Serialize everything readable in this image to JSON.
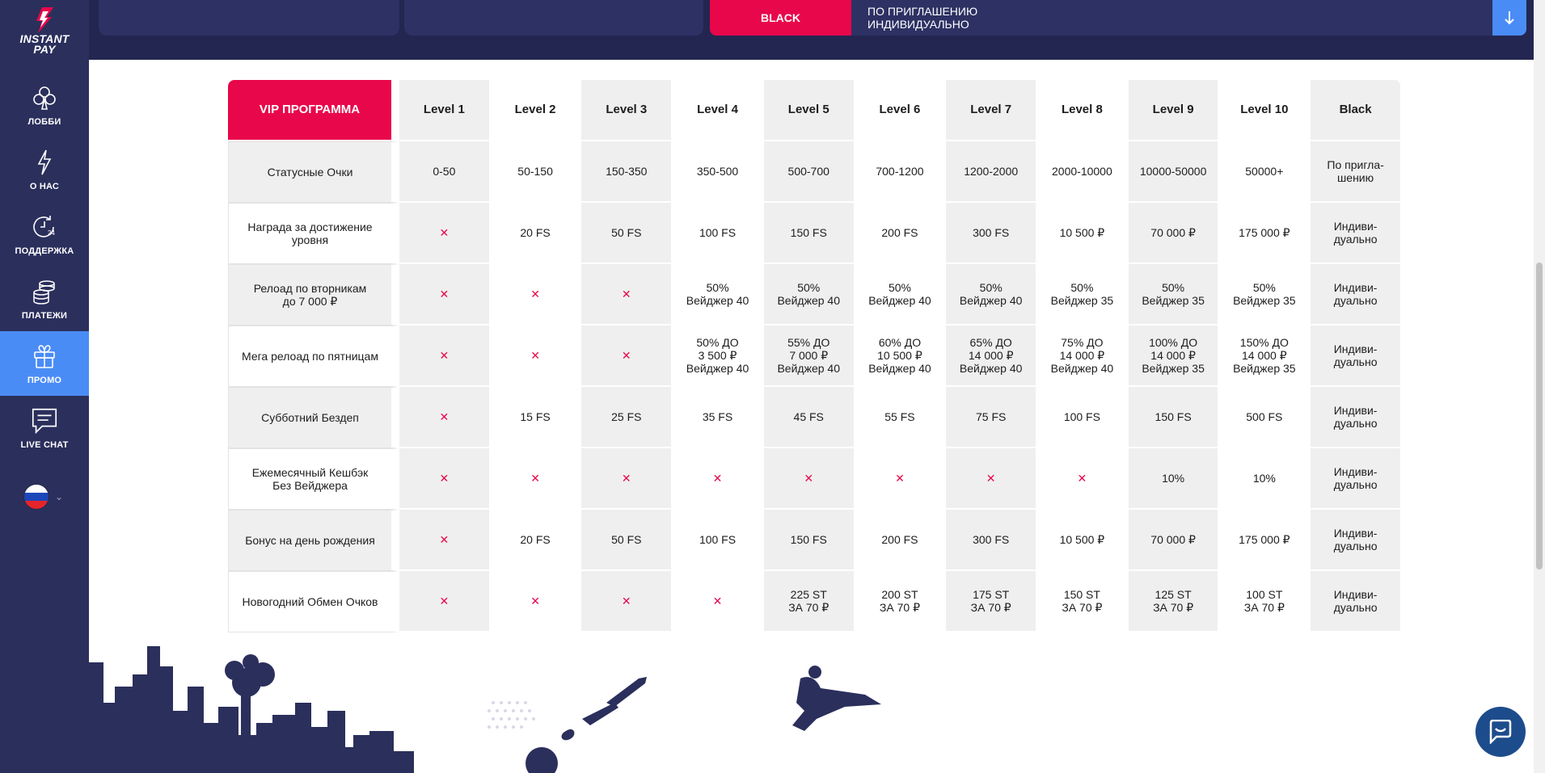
{
  "app": {
    "logo_line1": "INSTANT",
    "logo_line2": "PAY"
  },
  "sidebar": {
    "items": [
      {
        "label": "ЛОББИ",
        "icon": "club-icon"
      },
      {
        "label": "О НАС",
        "icon": "lightning-icon"
      },
      {
        "label": "ПОДДЕРЖКА",
        "icon": "clock-24-icon"
      },
      {
        "label": "ПЛАТЕЖИ",
        "icon": "coins-icon"
      },
      {
        "label": "ПРОМО",
        "icon": "gift-icon"
      },
      {
        "label": "LIVE CHAT",
        "icon": "chat-icon"
      }
    ],
    "active_index": 4,
    "language": "ru"
  },
  "top_banner": {
    "button": "BLACK",
    "text_line1": "ПО ПРИГЛАШЕНИЮ",
    "text_line2": "ИНДИВИДУАЛЬНО"
  },
  "table": {
    "corner": "VIP ПРОГРАММА",
    "columns": [
      "Level 1",
      "Level 2",
      "Level 3",
      "Level 4",
      "Level 5",
      "Level 6",
      "Level 7",
      "Level 8",
      "Level 9",
      "Level 10",
      "Black"
    ],
    "rows": [
      {
        "label": "Статусные Очки",
        "cells": [
          "0-50",
          "50-150",
          "150-350",
          "350-500",
          "500-700",
          "700-1200",
          "1200-2000",
          "2000-10000",
          "10000-50000",
          "50000+",
          "По пригла-\nшению"
        ]
      },
      {
        "label": "Награда за достижение\nуровня",
        "cells": [
          "✕",
          "20 FS",
          "50 FS",
          "100 FS",
          "150 FS",
          "200 FS",
          "300 FS",
          "10 500 ₽",
          "70 000 ₽",
          "175 000 ₽",
          "Индиви-\nдуально"
        ]
      },
      {
        "label": "Релоад по вторникам\nдо 7 000 ₽",
        "cells": [
          "✕",
          "✕",
          "✕",
          "50%\nВейджер 40",
          "50%\nВейджер 40",
          "50%\nВейджер 40",
          "50%\nВейджер 40",
          "50%\nВейджер 35",
          "50%\nВейджер 35",
          "50%\nВейджер 35",
          "Индиви-\nдуально"
        ]
      },
      {
        "label": "Мега релоад по пятницам",
        "cells": [
          "✕",
          "✕",
          "✕",
          "50% ДО\n3 500 ₽\nВейджер 40",
          "55% ДО\n7 000 ₽\nВейджер 40",
          "60% ДО\n10 500 ₽\nВейджер 40",
          "65% ДО\n14 000 ₽\nВейджер 40",
          "75% ДО\n14 000 ₽\nВейджер 40",
          "100% ДО\n14 000 ₽\nВейджер 35",
          "150% ДО\n14 000 ₽\nВейджер 35",
          "Индиви-\nдуально"
        ]
      },
      {
        "label": "Субботний Бездеп",
        "cells": [
          "✕",
          "15 FS",
          "25 FS",
          "35 FS",
          "45 FS",
          "55 FS",
          "75 FS",
          "100 FS",
          "150 FS",
          "500 FS",
          "Индиви-\nдуально"
        ]
      },
      {
        "label": "Ежемесячный Кешбэк\nБез Вейджера",
        "cells": [
          "✕",
          "✕",
          "✕",
          "✕",
          "✕",
          "✕",
          "✕",
          "✕",
          "10%",
          "10%",
          "Индиви-\nдуально"
        ]
      },
      {
        "label": "Бонус на день рождения",
        "cells": [
          "✕",
          "20 FS",
          "50 FS",
          "100 FS",
          "150 FS",
          "200 FS",
          "300 FS",
          "10 500 ₽",
          "70 000 ₽",
          "175 000 ₽",
          "Индиви-\nдуально"
        ]
      },
      {
        "label": "Новогодний Обмен Очков",
        "cells": [
          "✕",
          "✕",
          "✕",
          "✕",
          "225 ST\nЗА 70 ₽",
          "200 ST\nЗА 70 ₽",
          "175 ST\nЗА 70 ₽",
          "150 ST\nЗА 70 ₽",
          "125 ST\nЗА 70 ₽",
          "100 ST\nЗА 70 ₽",
          "Индиви-\nдуально"
        ]
      }
    ]
  },
  "colors": {
    "sidebar_bg": "#2b2f5c",
    "accent_red": "#e8074a",
    "accent_blue": "#4a8cf6",
    "cell_gray": "#efefef"
  }
}
